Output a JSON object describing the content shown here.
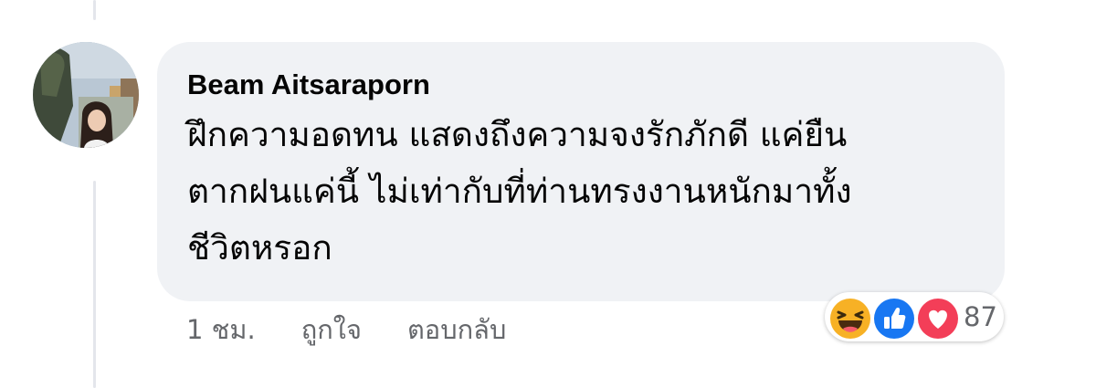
{
  "comment": {
    "author": "Beam Aitsaraporn",
    "text": "ฝึกความอดทน แสดงถึงความจงรักภักดี แค่ยืน\nตากฝนแค่นี้ ไม่เท่ากับที่ท่านทรงงานหนักมาทั้ง\nชีวิตหรอก",
    "timestamp": "1 ชม.",
    "like_label": "ถูกใจ",
    "reply_label": "ตอบกลับ"
  },
  "reactions": {
    "types": [
      "haha-icon",
      "like-icon",
      "love-icon"
    ],
    "count": "87",
    "colors": {
      "haha": "#f7b125",
      "like": "#1877f2",
      "love": "#f33e58"
    }
  },
  "colors": {
    "bubble": "#f0f2f5",
    "text": "#050505",
    "secondary_text": "#65676b",
    "thread_line": "#e4e6eb"
  }
}
